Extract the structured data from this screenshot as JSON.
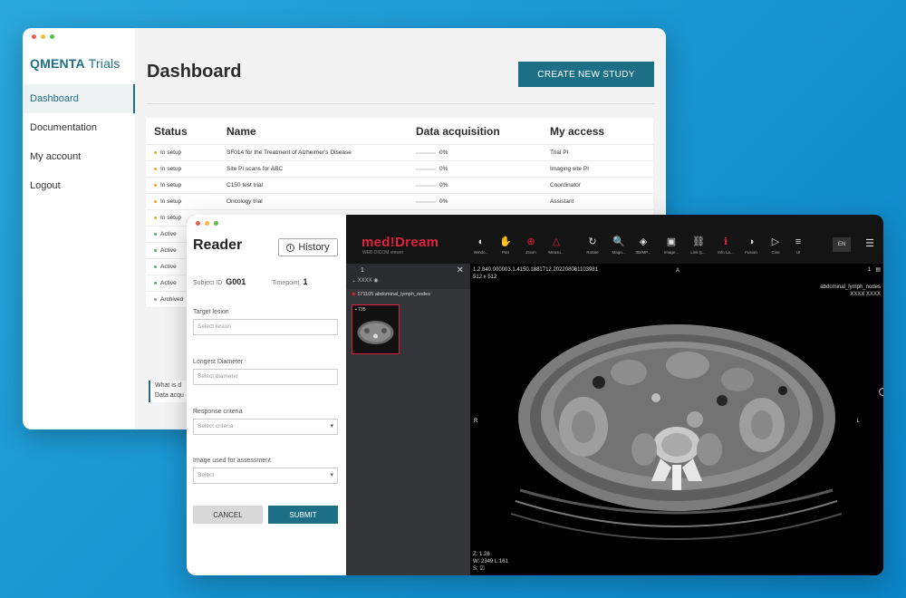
{
  "qmenta": {
    "logo_bold": "QMENTA",
    "logo_light": " Trials",
    "nav": [
      "Dashboard",
      "Documentation",
      "My account",
      "Logout"
    ],
    "title": "Dashboard",
    "create_button": "CREATE NEW STUDY",
    "columns": [
      "Status",
      "Name",
      "Data acquisition",
      "My access"
    ],
    "rows": [
      {
        "status": "In setup",
        "name": "SF014 for the Treatment of Alzheimer's Disease",
        "acq": "0%",
        "access": "Trial PI"
      },
      {
        "status": "In setup",
        "name": "Site PI scans for ABC",
        "acq": "0%",
        "access": "Imaging site PI"
      },
      {
        "status": "In setup",
        "name": "C150 test trial",
        "acq": "0%",
        "access": "Coordinator"
      },
      {
        "status": "In setup",
        "name": "Oncology trial",
        "acq": "0%",
        "access": "Assistant"
      },
      {
        "status": "In setup",
        "name": "",
        "acq": "",
        "access": ""
      },
      {
        "status": "Active",
        "name": "",
        "acq": "",
        "access": ""
      },
      {
        "status": "Active",
        "name": "",
        "acq": "",
        "access": ""
      },
      {
        "status": "Active",
        "name": "",
        "acq": "",
        "access": ""
      },
      {
        "status": "Active",
        "name": "",
        "acq": "",
        "access": ""
      },
      {
        "status": "Archived",
        "name": "",
        "acq": "",
        "access": ""
      }
    ],
    "info_line1": "What is d",
    "info_line2": "Data acqu"
  },
  "reader": {
    "title": "Reader",
    "history_button": "History",
    "subject_label": "Subject ID",
    "subject_value": "G001",
    "timepoint_label": "Timepoint",
    "timepoint_value": "1",
    "fields": [
      {
        "label": "Target lesion",
        "placeholder": "Select lesion",
        "select": false
      },
      {
        "label": "Longest Diameter",
        "placeholder": "Select diameter",
        "select": false
      },
      {
        "label": "Response criteria",
        "placeholder": "Select criteria",
        "select": true
      },
      {
        "label": "Image used for assessment",
        "placeholder": "Select",
        "select": true
      }
    ],
    "cancel_button": "CANCEL",
    "submit_button": "SUBMIT"
  },
  "viewer": {
    "logo": "med!Dream",
    "logo_sub": "WEB DICOM viewer",
    "tools": [
      {
        "label": "Windo...",
        "icon": "contrast-icon",
        "glyph": "◐",
        "red": false
      },
      {
        "label": "Pan",
        "icon": "pan-icon",
        "glyph": "✋",
        "red": true
      },
      {
        "label": "Zoom",
        "icon": "zoom-icon",
        "glyph": "⊕",
        "red": true
      },
      {
        "label": "Measu...",
        "icon": "measure-icon",
        "glyph": "△",
        "red": true
      },
      {
        "label": "Rotate",
        "icon": "rotate-icon",
        "glyph": "↻",
        "red": false
      },
      {
        "label": "Magn...",
        "icon": "magnify-icon",
        "glyph": "🔍",
        "red": false
      },
      {
        "label": "3D/MP...",
        "icon": "layers-icon",
        "glyph": "◈",
        "red": false
      },
      {
        "label": "Image...",
        "icon": "image-icon",
        "glyph": "▣",
        "red": false
      },
      {
        "label": "Link (L...",
        "icon": "link-icon",
        "glyph": "⛓",
        "red": false
      },
      {
        "label": "Info La...",
        "icon": "info-icon",
        "glyph": "ℹ",
        "red": true
      },
      {
        "label": "Fusion",
        "icon": "fusion-icon",
        "glyph": "◑",
        "red": false
      },
      {
        "label": "Cine",
        "icon": "play-icon",
        "glyph": "▷",
        "red": false
      },
      {
        "label": "UI",
        "icon": "menu-icon",
        "glyph": "≡",
        "red": false
      }
    ],
    "lang": "EN",
    "series_number": "1",
    "series_sub": "XXXX",
    "series_name": "171105 abdominal_lymph_nodes",
    "thumb_count": "735",
    "overlay_uid": "1.2.840.000003.1.4150.1881712.202208061103981",
    "overlay_size": "512 x 512",
    "overlay_top": "A",
    "overlay_right_num": "1",
    "overlay_desc": "abdominal_lymph_nodes",
    "overlay_id": "XXXX XXXX",
    "overlay_left": "R",
    "overlay_right": "L",
    "overlay_zoom": "Z: 1.26",
    "overlay_wl": "W: 2349 L:161",
    "overlay_s": "S:"
  }
}
